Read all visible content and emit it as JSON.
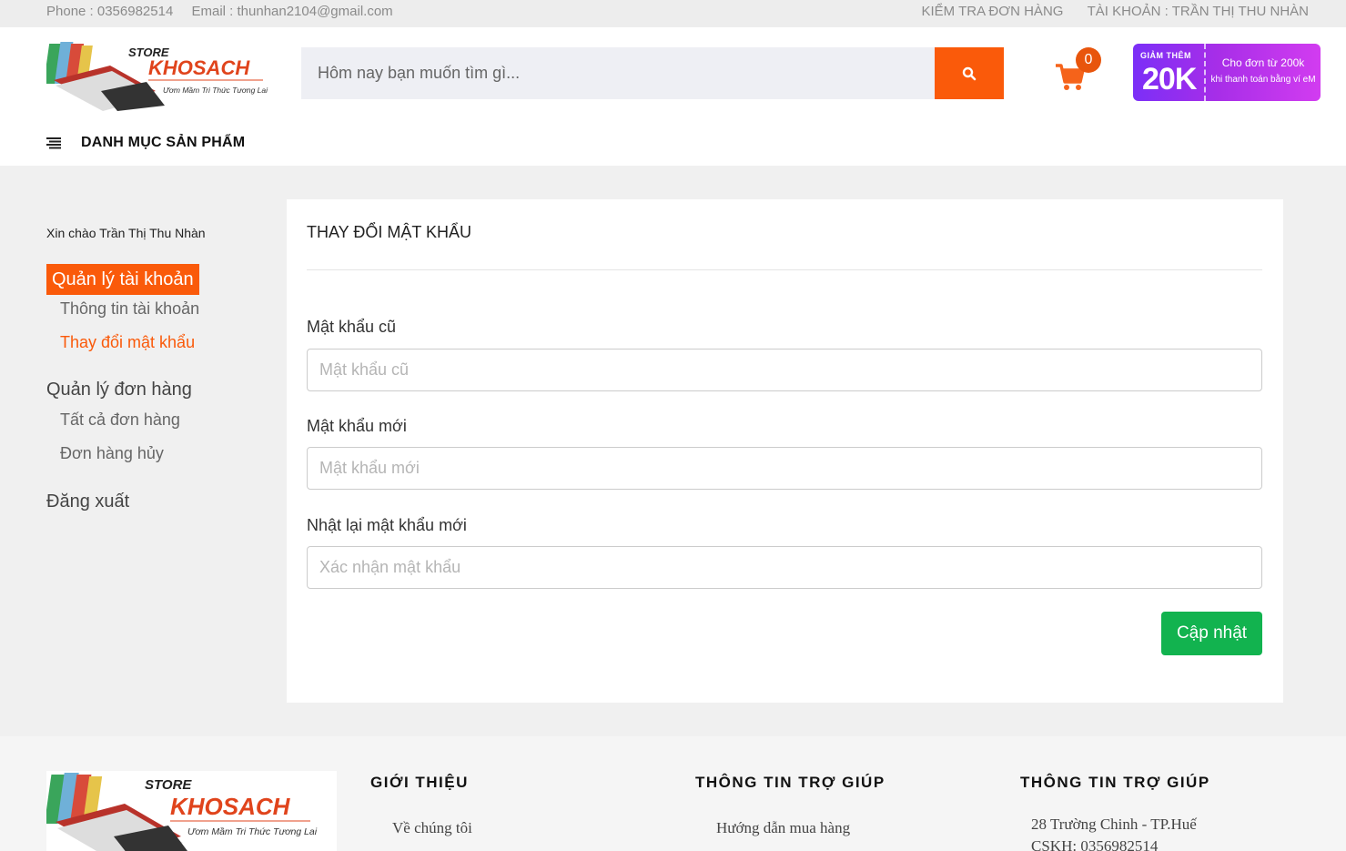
{
  "topbar": {
    "phone": "Phone : 0356982514",
    "email": "Email : thunhan2104@gmail.com",
    "check_order": "KIỂM TRA ĐƠN HÀNG",
    "account": "TÀI KHOẢN : TRẦN THỊ THU NHÀN"
  },
  "logo": {
    "store": "STORE",
    "name": "KHOSACH",
    "slogan": "Ươm Mầm Tri Thức Tương Lai"
  },
  "search": {
    "placeholder": "Hôm nay bạn muốn tìm gì..."
  },
  "cart": {
    "count": "0"
  },
  "promo": {
    "label": "GIẢM THÊM",
    "amount": "20K",
    "line1": "Cho đơn từ 200k",
    "line2": "khi thanh toán bằng ví eM"
  },
  "menu": {
    "label": "DANH MỤC SẢN PHẨM"
  },
  "sidebar": {
    "greeting": "Xin chào Trần Thị Thu Nhàn",
    "account_mgmt": "Quản lý tài khoản",
    "account_info": "Thông tin tài khoản",
    "change_password": "Thay đổi mật khẩu",
    "order_mgmt": "Quản lý đơn hàng",
    "all_orders": "Tất cả đơn hàng",
    "cancelled_orders": "Đơn hàng hủy",
    "logout": "Đăng xuất"
  },
  "form": {
    "title": "THAY ĐỔI MẬT KHẨU",
    "old_label": "Mật khẩu cũ",
    "old_placeholder": "Mật khẩu cũ",
    "new_label": "Mật khẩu mới",
    "new_placeholder": "Mật khẩu mới",
    "confirm_label": "Nhật lại mật khẩu mới",
    "confirm_placeholder": "Xác nhận mật khẩu",
    "submit": "Cập nhật"
  },
  "footer": {
    "about_title": "GIỚI THIỆU",
    "about_item": "Về chúng tôi",
    "help_title": "THÔNG TIN TRỢ GIÚP",
    "help_item": "Hướng dẫn mua hàng",
    "contact_title": "THÔNG TIN TRỢ GIÚP",
    "address": "28 Trường Chinh - TP.Huế",
    "cskh": "CSKH: 0356982514"
  },
  "colors": {
    "accent": "#fa5a0a",
    "success": "#12b34f",
    "promo": "#a72ee8"
  }
}
